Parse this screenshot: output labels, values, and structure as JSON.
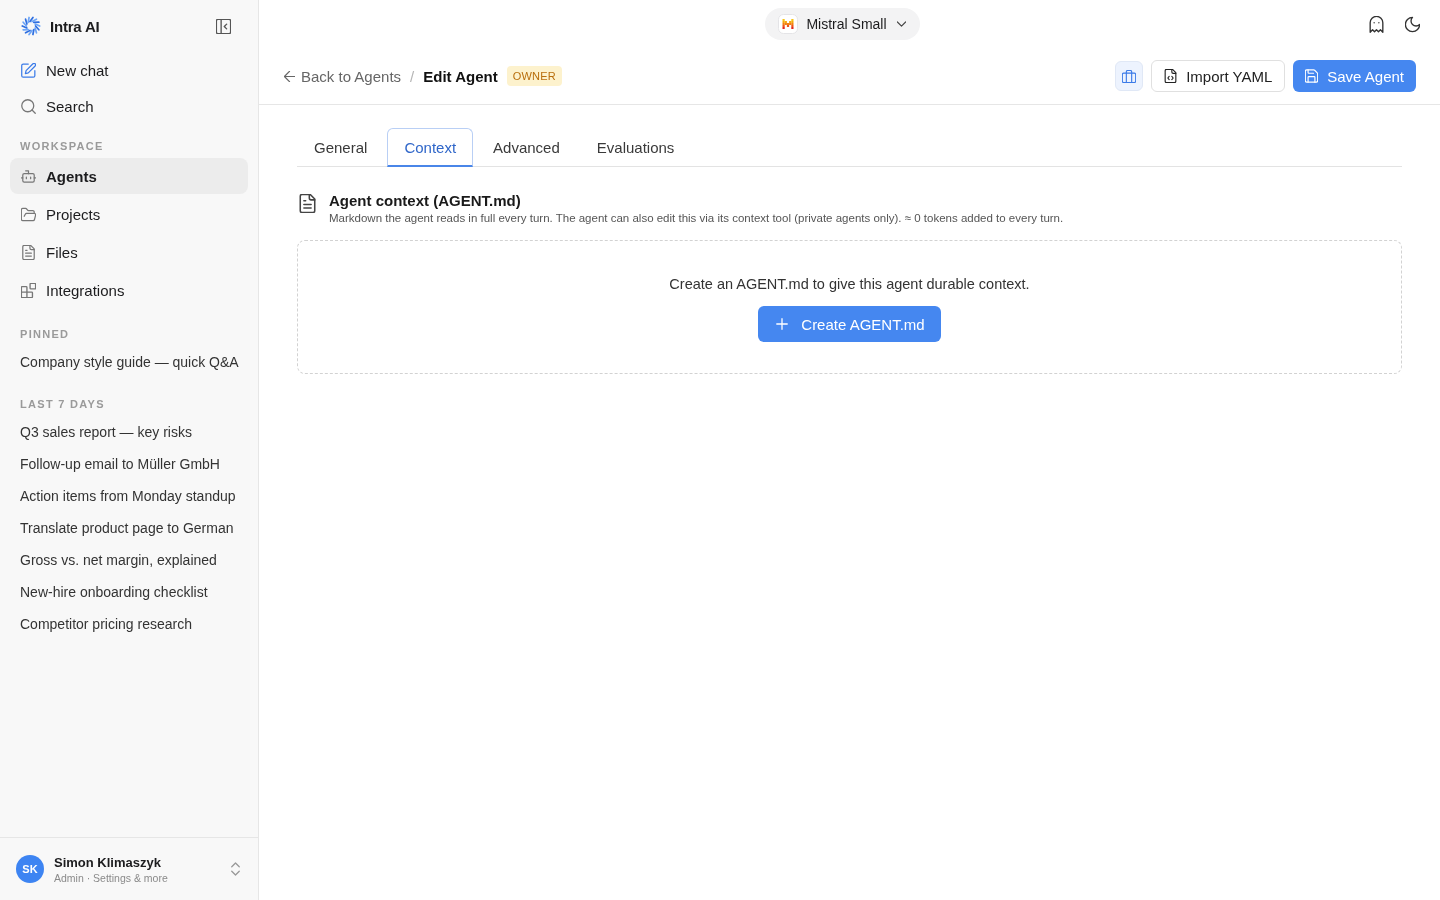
{
  "sidebar": {
    "brand": "Intra AI",
    "actions": [
      "New chat",
      "Search"
    ],
    "sections": [
      {
        "kind": "nav",
        "heading": "WORKSPACE",
        "items": [
          {
            "label": "Agents",
            "selected": true
          },
          {
            "label": "Projects",
            "selected": false
          },
          {
            "label": "Files",
            "selected": false
          },
          {
            "label": "Integrations",
            "selected": false
          }
        ]
      },
      {
        "kind": "history",
        "heading": "PINNED",
        "items": [
          {
            "label": "Company style guide — quick Q&A",
            "selected": false
          }
        ]
      },
      {
        "kind": "history",
        "heading": "LAST 7 DAYS",
        "items": [
          {
            "label": "Q3 sales report — key risks",
            "selected": false
          },
          {
            "label": "Follow-up email to Müller GmbH",
            "selected": false
          },
          {
            "label": "Action items from Monday standup",
            "selected": false
          },
          {
            "label": "Translate product page to German",
            "selected": false
          },
          {
            "label": "Gross vs. net margin, explained",
            "selected": false
          },
          {
            "label": "New-hire onboarding checklist",
            "selected": false
          },
          {
            "label": "Competitor pricing research",
            "selected": false
          }
        ]
      }
    ],
    "user": {
      "initials": "SK",
      "name": "Simon Klimaszyk",
      "subtitle": "Admin · Settings & more"
    }
  },
  "top_bar": {
    "model": "Mistral Small"
  },
  "header": {
    "breadcrumb": {
      "back": "Back to Agents",
      "separator": "/",
      "current": "Edit Agent",
      "badge": "OWNER"
    },
    "buttons": [
      {
        "kind": "toggle",
        "on": true
      },
      {
        "kind": "secondary",
        "label": "Import YAML"
      },
      {
        "kind": "primary",
        "label": "Save Agent"
      }
    ]
  },
  "tabs": [
    {
      "label": "General",
      "selected": false
    },
    {
      "label": "Context",
      "selected": true
    },
    {
      "label": "Advanced",
      "selected": false
    },
    {
      "label": "Evaluations",
      "selected": false
    }
  ],
  "context": {
    "title": "Agent context (AGENT.md)",
    "description": "Markdown the agent reads in full every turn. The agent can also edit this via its context tool (private agents only). ≈ 0 tokens added to every turn.",
    "empty_state": {
      "message": "Create an AGENT.md to give this agent durable context.",
      "button": "Create AGENT.md"
    }
  }
}
